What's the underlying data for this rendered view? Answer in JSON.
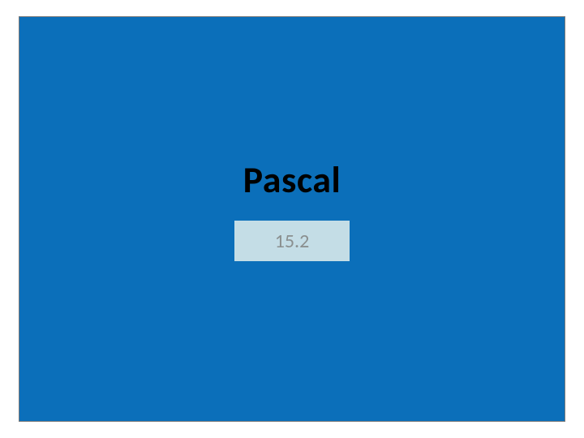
{
  "slide": {
    "title": "Pascal",
    "subtitle": "15.2",
    "colors": {
      "background": "#0b6fba",
      "subtitle_box": "#c4dde6",
      "title_text": "#000000",
      "subtitle_text": "#8a8f8f"
    }
  }
}
